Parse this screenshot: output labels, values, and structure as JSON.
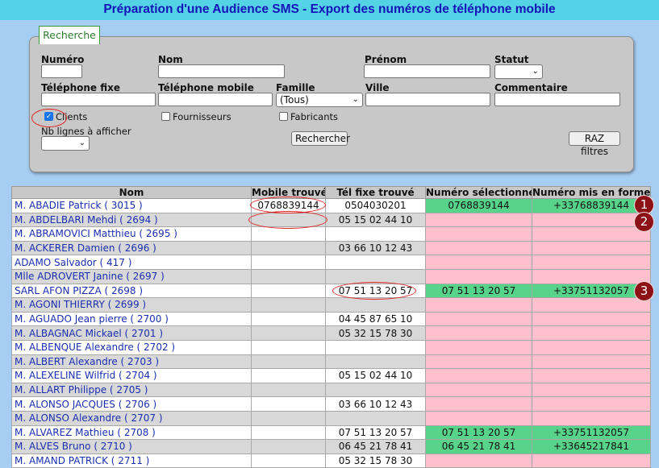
{
  "title": "Préparation d'une Audience SMS - Export des numéros de téléphone mobile",
  "search": {
    "tab_label": "Recherche",
    "labels": {
      "numero": "Numéro",
      "nom": "Nom",
      "prenom": "Prénom",
      "statut": "Statut",
      "tel_fixe": "Téléphone fixe",
      "tel_mobile": "Téléphone mobile",
      "famille": "Famille",
      "ville": "Ville",
      "commentaire": "Commentaire",
      "nb_lignes": "Nb lignes à afficher"
    },
    "famille_value": "(Tous)",
    "checkboxes": {
      "clients": "Clients",
      "fournisseurs": "Fournisseurs",
      "fabricants": "Fabricants"
    },
    "search_button": "Rechercher",
    "reset_button": "RAZ filtres"
  },
  "table": {
    "headers": [
      "Nom",
      "Mobile trouvé",
      "Tél fixe trouvé",
      "Numéro sélectionné",
      "Numéro mis en forme"
    ],
    "rows": [
      {
        "nom": "M. ABADIE Patrick ( 3015 )",
        "mobile": "0768839144",
        "fixe": "0504030201",
        "sel": "0768839144",
        "forme": "+33768839144",
        "status": "ok"
      },
      {
        "nom": "M. ABDELBARI Mehdi ( 2694 )",
        "mobile": "",
        "fixe": "05 15 02 44 10",
        "sel": "",
        "forme": "",
        "status": "ko"
      },
      {
        "nom": "M. ABRAMOVICI Matthieu ( 2695 )",
        "mobile": "",
        "fixe": "",
        "sel": "",
        "forme": "",
        "status": "ko"
      },
      {
        "nom": "M. ACKERER Damien ( 2696 )",
        "mobile": "",
        "fixe": "03 66 10 12 43",
        "sel": "",
        "forme": "",
        "status": "ko"
      },
      {
        "nom": "ADAMO Salvador ( 417 )",
        "mobile": "",
        "fixe": "",
        "sel": "",
        "forme": "",
        "status": "ko"
      },
      {
        "nom": "Mlle ADROVERT Janine ( 2697 )",
        "mobile": "",
        "fixe": "",
        "sel": "",
        "forme": "",
        "status": "ko"
      },
      {
        "nom": "SARL AFON PIZZA ( 2698 )",
        "mobile": "",
        "fixe": "07 51 13 20 57",
        "sel": "07 51 13 20 57",
        "forme": "+33751132057",
        "status": "ok"
      },
      {
        "nom": "M. AGONI THIERRY ( 2699 )",
        "mobile": "",
        "fixe": "",
        "sel": "",
        "forme": "",
        "status": "ko"
      },
      {
        "nom": "M. AGUADO Jean pierre ( 2700 )",
        "mobile": "",
        "fixe": "04 45 87 65 10",
        "sel": "",
        "forme": "",
        "status": "ko"
      },
      {
        "nom": "M. ALBAGNAC Mickael ( 2701 )",
        "mobile": "",
        "fixe": "05 32 15 78 30",
        "sel": "",
        "forme": "",
        "status": "ko"
      },
      {
        "nom": "M. ALBENQUE Alexandre ( 2702 )",
        "mobile": "",
        "fixe": "",
        "sel": "",
        "forme": "",
        "status": "ko"
      },
      {
        "nom": "M. ALBERT Alexandre ( 2703 )",
        "mobile": "",
        "fixe": "",
        "sel": "",
        "forme": "",
        "status": "ko"
      },
      {
        "nom": "M. ALEXELINE Wilfrid ( 2704 )",
        "mobile": "",
        "fixe": "05 15 02 44 10",
        "sel": "",
        "forme": "",
        "status": "ko"
      },
      {
        "nom": "M. ALLART Philippe ( 2705 )",
        "mobile": "",
        "fixe": "",
        "sel": "",
        "forme": "",
        "status": "ko"
      },
      {
        "nom": "M. ALONSO JACQUES ( 2706 )",
        "mobile": "",
        "fixe": "03 66 10 12 43",
        "sel": "",
        "forme": "",
        "status": "ko"
      },
      {
        "nom": "M. ALONSO Alexandre ( 2707 )",
        "mobile": "",
        "fixe": "",
        "sel": "",
        "forme": "",
        "status": "ko"
      },
      {
        "nom": "M. ALVAREZ Mathieu ( 2708 )",
        "mobile": "",
        "fixe": "07 51 13 20 57",
        "sel": "07 51 13 20 57",
        "forme": "+33751132057",
        "status": "ok"
      },
      {
        "nom": "M. ALVES Bruno ( 2710 )",
        "mobile": "",
        "fixe": "06 45 21 78 41",
        "sel": "06 45 21 78 41",
        "forme": "+33645217841",
        "status": "ok"
      },
      {
        "nom": "M. AMAND PATRICK ( 2711 )",
        "mobile": "",
        "fixe": "05 32 15 78 30",
        "sel": "",
        "forme": "",
        "status": "ko"
      }
    ]
  },
  "annotations": {
    "badges": [
      "1",
      "2",
      "3"
    ],
    "oval_color": "#e02020",
    "badge_color": "#8c1218"
  },
  "colors": {
    "title_bg": "#55d3e6",
    "title_text": "#1414b8",
    "page_bg": "#a6cdf2",
    "ok_cell": "#57d489",
    "ko_cell": "#ffbfcc",
    "name_link": "#1a2fb0"
  }
}
